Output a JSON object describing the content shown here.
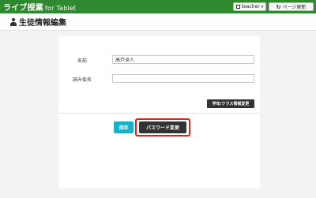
{
  "app": {
    "brand": "ライブ授業",
    "brand_sub": "for Tablet",
    "teacher_label": "teacher",
    "reload_label": "ページ更新"
  },
  "header": {
    "title": "生徒情報編集"
  },
  "form": {
    "name_label": "名前",
    "name_value": "高戸卓人",
    "kana_label": "読み仮名",
    "kana_value": "",
    "grade_class_button": "学年/クラス情報変更",
    "save_button": "保存",
    "password_button": "パスワード変更"
  },
  "colors": {
    "topbar": "#2f8a2f",
    "save": "#17b2c9",
    "dark_button": "#333333",
    "highlight": "#d9241b"
  }
}
